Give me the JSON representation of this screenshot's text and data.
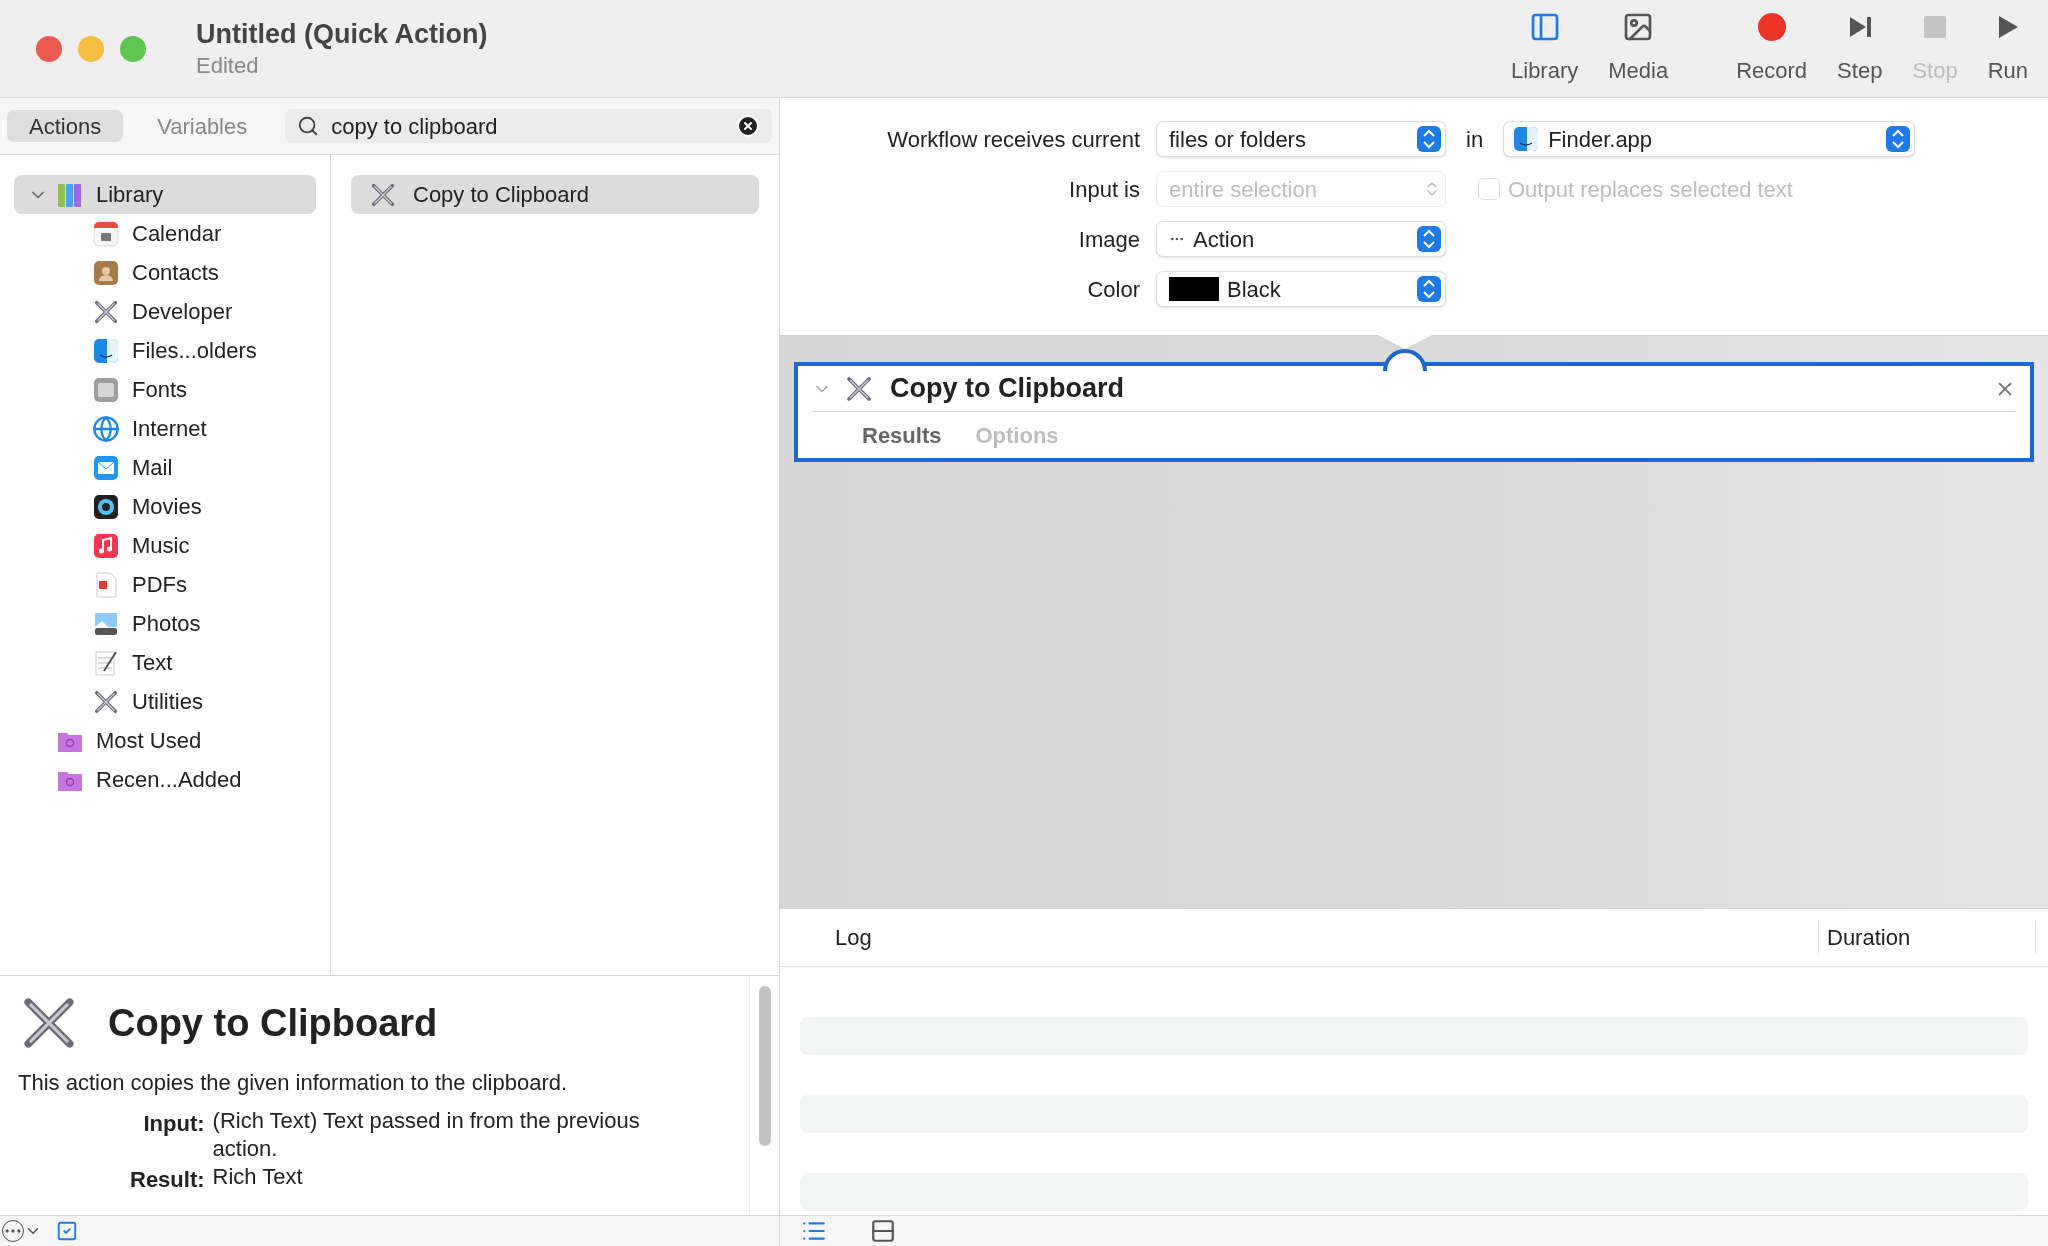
{
  "window": {
    "title": "Untitled (Quick Action)",
    "subtitle": "Edited"
  },
  "toolbar": [
    {
      "kind": "library",
      "label": "Library",
      "disabled": false
    },
    {
      "kind": "media",
      "label": "Media",
      "disabled": false
    },
    {
      "kind": "record",
      "label": "Record",
      "disabled": false
    },
    {
      "kind": "step",
      "label": "Step",
      "disabled": false
    },
    {
      "kind": "stop",
      "label": "Stop",
      "disabled": true
    },
    {
      "kind": "run",
      "label": "Run",
      "disabled": false
    }
  ],
  "left_tabs": [
    {
      "label": "Actions",
      "selected": true
    },
    {
      "label": "Variables",
      "selected": false
    }
  ],
  "search": {
    "value": "copy to clipboard"
  },
  "library": [
    {
      "label": "Library",
      "kind": "library",
      "expanded": true,
      "selected": true,
      "children": [
        {
          "label": "Calendar",
          "kind": "calendar"
        },
        {
          "label": "Contacts",
          "kind": "contacts"
        },
        {
          "label": "Developer",
          "kind": "tools"
        },
        {
          "label": "Files...olders",
          "kind": "finder"
        },
        {
          "label": "Fonts",
          "kind": "fonts"
        },
        {
          "label": "Internet",
          "kind": "globe"
        },
        {
          "label": "Mail",
          "kind": "mail"
        },
        {
          "label": "Movies",
          "kind": "movies"
        },
        {
          "label": "Music",
          "kind": "music"
        },
        {
          "label": "PDFs",
          "kind": "pdf"
        },
        {
          "label": "Photos",
          "kind": "photos"
        },
        {
          "label": "Text",
          "kind": "text"
        },
        {
          "label": "Utilities",
          "kind": "tools"
        }
      ]
    },
    {
      "label": "Most Used",
      "kind": "folder",
      "selected": false
    },
    {
      "label": "Recen...Added",
      "kind": "folder",
      "selected": false
    }
  ],
  "results": [
    {
      "label": "Copy to Clipboard",
      "selected": true
    }
  ],
  "description": {
    "title": "Copy to Clipboard",
    "text": "This action copies the given information to the clipboard.",
    "fields": [
      {
        "label": "Input:",
        "value": "(Rich Text) Text passed in from the previous action."
      },
      {
        "label": "Result:",
        "value": "Rich Text"
      }
    ]
  },
  "workflow_settings": [
    {
      "label": "Workflow receives current",
      "kind": "popup",
      "value": "files or folders",
      "disabled": false,
      "target": {
        "connector": "in",
        "value": "Finder.app"
      }
    },
    {
      "label": "Input is",
      "kind": "popup",
      "value": "entire selection",
      "disabled": true,
      "checkbox": {
        "label": "Output replaces selected text",
        "checked": false,
        "disabled": true
      }
    },
    {
      "label": "Image",
      "kind": "image_popup",
      "value": "Action",
      "disabled": false
    },
    {
      "label": "Color",
      "kind": "color_popup",
      "value": "Black",
      "color": "#000000",
      "disabled": false
    }
  ],
  "action_card": {
    "title": "Copy to Clipboard",
    "expanded": true,
    "selected": true,
    "tabs": [
      {
        "label": "Results",
        "selected": true
      },
      {
        "label": "Options",
        "selected": false
      }
    ]
  },
  "log": {
    "columns": [
      "Log",
      "Duration"
    ]
  }
}
